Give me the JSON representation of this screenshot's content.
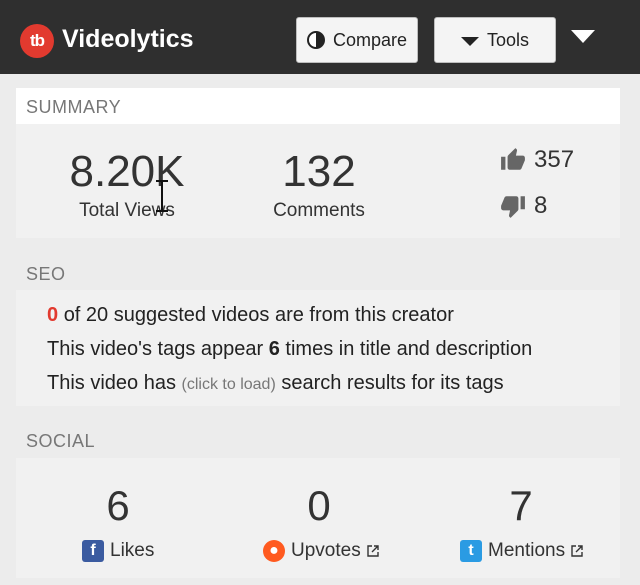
{
  "app": {
    "brand": "Videolytics",
    "logo_text": "tb"
  },
  "header": {
    "compare_label": "Compare",
    "tools_label": "Tools"
  },
  "summary": {
    "label": "SUMMARY",
    "views_value": "8.20K",
    "views_label": "Total Views",
    "comments_value": "132",
    "comments_label": "Comments",
    "likes": "357",
    "dislikes": "8"
  },
  "seo": {
    "label": "SEO",
    "line1_count": "0",
    "line1_rest": "of 20 suggested videos are from this creator",
    "line2_pre": "This video's tags appear",
    "line2_count": "6",
    "line2_post": "times in title and description",
    "line3_pre": "This video has",
    "line3_link": "(click to load)",
    "line3_post": "search results for its tags"
  },
  "social": {
    "label": "SOCIAL",
    "likes_value": "6",
    "likes_label": "Likes",
    "upvotes_value": "0",
    "upvotes_label": "Upvotes",
    "mentions_value": "7",
    "mentions_label": "Mentions"
  },
  "icons": {
    "logo": "tubebuddy-logo-icon",
    "compare": "half-circle-icon",
    "tools": "triangle-down-icon",
    "menu": "caret-down-icon",
    "like": "thumbs-up-icon",
    "dislike": "thumbs-down-icon",
    "facebook": "facebook-icon",
    "reddit": "reddit-icon",
    "twitter": "twitter-icon",
    "external": "external-link-icon"
  },
  "colors": {
    "accent_red": "#e23a2f",
    "header_bg": "#2f2f2f"
  }
}
